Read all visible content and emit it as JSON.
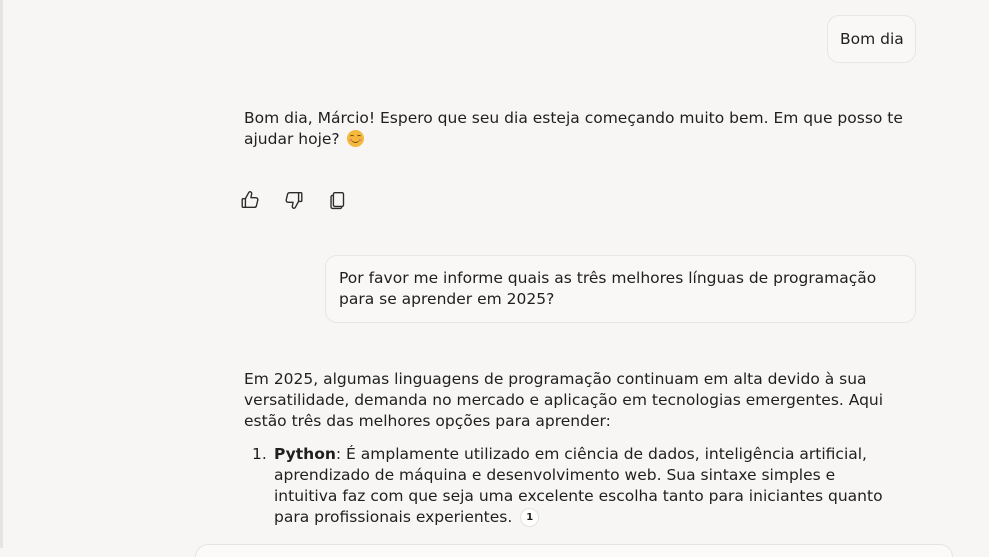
{
  "conversation": {
    "user_message_1": "Bom dia",
    "assistant_reply_1": "Bom dia, Márcio! Espero que seu dia esteja começando muito bem. Em que posso te ajudar hoje?",
    "reply_actions": {
      "like_icon": "thumbs-up-icon",
      "dislike_icon": "thumbs-down-icon",
      "copy_icon": "copy-icon"
    },
    "user_message_2": "Por favor me informe quais as três melhores línguas de programação para se aprender em 2025?",
    "assistant_reply_2": {
      "intro": "Em 2025, algumas linguagens de programação continuam em alta devido à sua versatilidade, demanda no mercado e aplicação em tecnologias emergentes. Aqui estão três das melhores opções para aprender:",
      "items": [
        {
          "number": "1.",
          "name": "Python",
          "text": ": É amplamente utilizado em ciência de dados, inteligência artificial, aprendizado de máquina e desenvolvimento web. Sua sintaxe simples e intuitiva faz com que seja uma excelente escolha tanto para iniciantes quanto para profissionais experientes.",
          "citation": "1"
        }
      ]
    }
  },
  "colors": {
    "background": "#f7f6f5",
    "bubble": "#f9f8f7",
    "text": "#1f1f1f"
  }
}
